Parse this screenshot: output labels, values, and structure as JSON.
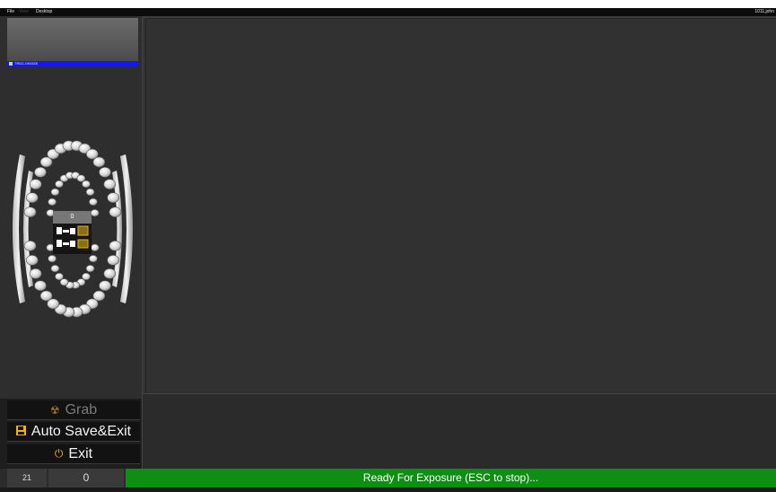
{
  "menubar": {
    "file_label": "File",
    "view_label": "View",
    "desktop_label": "Desktop",
    "user_label": "1011,john"
  },
  "sidebar": {
    "thumbnail_label": "TRD2-190003I",
    "counter_value": "0"
  },
  "buttons": {
    "grab_label": "Grab",
    "auto_save_exit_label": "Auto Save&Exit",
    "exit_label": "Exit"
  },
  "statusbar": {
    "count_left": "21",
    "count_right": "0",
    "message": "Ready For Exposure (ESC to stop)..."
  },
  "colors": {
    "status_green": "#0e8f14",
    "selection_blue": "#1414ff",
    "accent_yellow": "#f0b400"
  },
  "icons": {
    "grab": "radiation-icon",
    "save": "floppy-disk-icon",
    "exit": "power-icon"
  }
}
